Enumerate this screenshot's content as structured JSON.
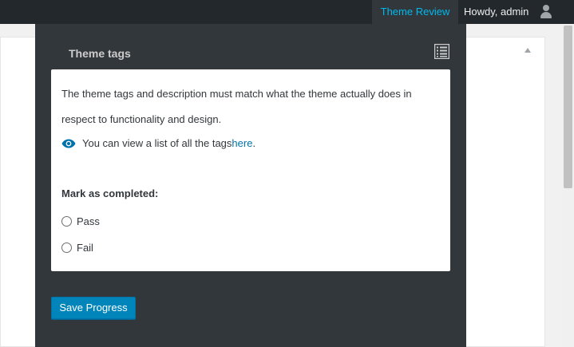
{
  "adminbar": {
    "theme_review": "Theme Review",
    "howdy": "Howdy, admin",
    "avatar_icon": "user-icon"
  },
  "panel": {
    "title": "Theme tags",
    "list_icon": "list-icon",
    "description": "The theme tags and description must match what the theme actually does in respect to functionality and design.",
    "view_prefix": "You can view a list of all the tags ",
    "view_link": "here",
    "view_suffix": ".",
    "eye_icon": "eye-icon",
    "mark_label": "Mark as completed:",
    "options": [
      {
        "label": "Pass",
        "checked": false
      },
      {
        "label": "Fail",
        "checked": false
      }
    ],
    "save_label": "Save Progress"
  },
  "colors": {
    "adminbar_bg": "#23282d",
    "panel_bg": "#32373c",
    "accent": "#00b9eb",
    "button_bg": "#0085ba",
    "link": "#0073aa"
  }
}
